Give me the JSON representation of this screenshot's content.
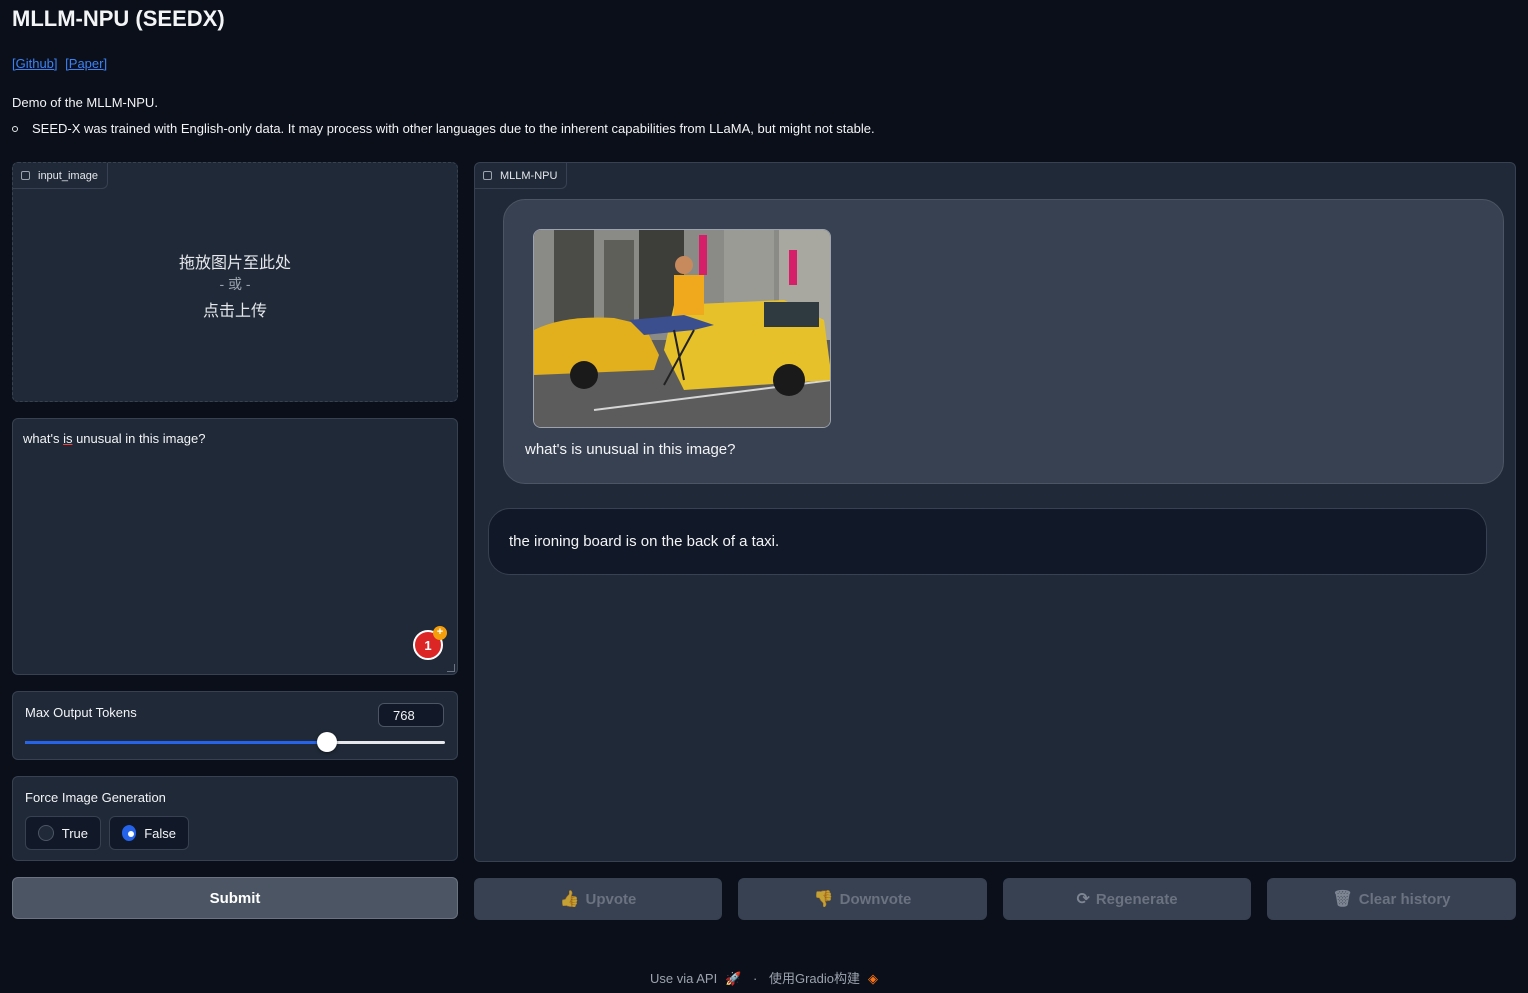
{
  "header": {
    "title": "MLLM-NPU (SEEDX)",
    "links": [
      "[Github]",
      "[Paper]"
    ],
    "description": "Demo of the MLLM-NPU.",
    "note": "SEED-X was trained with English-only data. It may process with other languages due to the inherent capabilities from LLaMA, but might not stable."
  },
  "image_input": {
    "label": "input_image",
    "drop_text": "拖放图片至此处",
    "or_text": "- 或 -",
    "click_text": "点击上传"
  },
  "prompt": {
    "value_before": "what's ",
    "value_underlined": "is",
    "value_after": " unusual in this image?",
    "grammar_count": "1"
  },
  "max_tokens": {
    "label": "Max Output Tokens",
    "value": "768",
    "fraction": 0.72
  },
  "force_image": {
    "label": "Force Image Generation",
    "options": [
      "True",
      "False"
    ],
    "selected": "False"
  },
  "submit_label": "Submit",
  "chatbot": {
    "label": "MLLM-NPU",
    "user_message": "what's is unusual in this image?",
    "bot_message": "the ironing board is on the back of a taxi."
  },
  "actions": {
    "upvote": "Upvote",
    "downvote": "Downvote",
    "regenerate": "Regenerate",
    "clear": "Clear history"
  },
  "footer": {
    "api": "Use via API",
    "sep": "·",
    "built": "使用Gradio构建"
  },
  "colors": {
    "background": "#0b0f19",
    "panel": "#1f2937",
    "accent": "#2563eb",
    "link": "#3b82f6"
  }
}
